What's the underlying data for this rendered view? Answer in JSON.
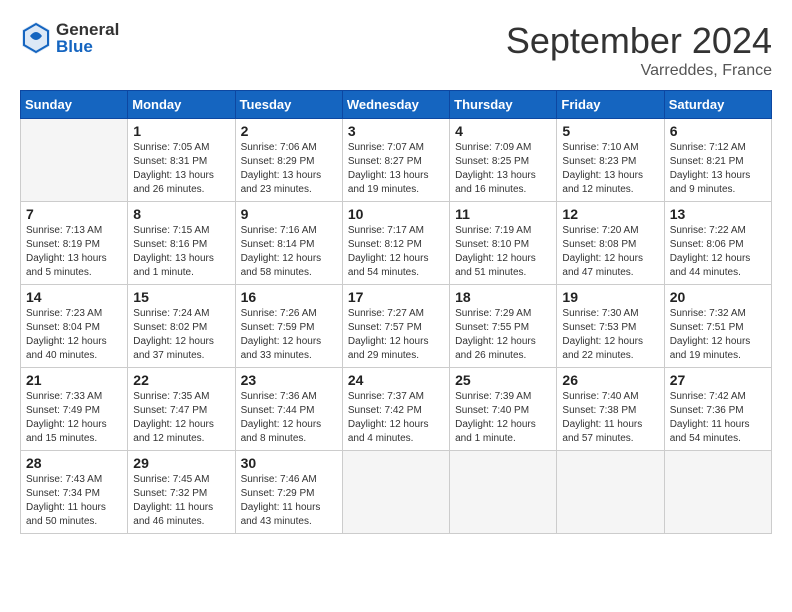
{
  "header": {
    "logo_general": "General",
    "logo_blue": "Blue",
    "month_title": "September 2024",
    "subtitle": "Varreddes, France"
  },
  "weekdays": [
    "Sunday",
    "Monday",
    "Tuesday",
    "Wednesday",
    "Thursday",
    "Friday",
    "Saturday"
  ],
  "days": [
    {
      "num": "",
      "info": "",
      "empty": true
    },
    {
      "num": "1",
      "info": "Sunrise: 7:05 AM\nSunset: 8:31 PM\nDaylight: 13 hours\nand 26 minutes."
    },
    {
      "num": "2",
      "info": "Sunrise: 7:06 AM\nSunset: 8:29 PM\nDaylight: 13 hours\nand 23 minutes."
    },
    {
      "num": "3",
      "info": "Sunrise: 7:07 AM\nSunset: 8:27 PM\nDaylight: 13 hours\nand 19 minutes."
    },
    {
      "num": "4",
      "info": "Sunrise: 7:09 AM\nSunset: 8:25 PM\nDaylight: 13 hours\nand 16 minutes."
    },
    {
      "num": "5",
      "info": "Sunrise: 7:10 AM\nSunset: 8:23 PM\nDaylight: 13 hours\nand 12 minutes."
    },
    {
      "num": "6",
      "info": "Sunrise: 7:12 AM\nSunset: 8:21 PM\nDaylight: 13 hours\nand 9 minutes."
    },
    {
      "num": "7",
      "info": "Sunrise: 7:13 AM\nSunset: 8:19 PM\nDaylight: 13 hours\nand 5 minutes."
    },
    {
      "num": "8",
      "info": "Sunrise: 7:15 AM\nSunset: 8:16 PM\nDaylight: 13 hours\nand 1 minute."
    },
    {
      "num": "9",
      "info": "Sunrise: 7:16 AM\nSunset: 8:14 PM\nDaylight: 12 hours\nand 58 minutes."
    },
    {
      "num": "10",
      "info": "Sunrise: 7:17 AM\nSunset: 8:12 PM\nDaylight: 12 hours\nand 54 minutes."
    },
    {
      "num": "11",
      "info": "Sunrise: 7:19 AM\nSunset: 8:10 PM\nDaylight: 12 hours\nand 51 minutes."
    },
    {
      "num": "12",
      "info": "Sunrise: 7:20 AM\nSunset: 8:08 PM\nDaylight: 12 hours\nand 47 minutes."
    },
    {
      "num": "13",
      "info": "Sunrise: 7:22 AM\nSunset: 8:06 PM\nDaylight: 12 hours\nand 44 minutes."
    },
    {
      "num": "14",
      "info": "Sunrise: 7:23 AM\nSunset: 8:04 PM\nDaylight: 12 hours\nand 40 minutes."
    },
    {
      "num": "15",
      "info": "Sunrise: 7:24 AM\nSunset: 8:02 PM\nDaylight: 12 hours\nand 37 minutes."
    },
    {
      "num": "16",
      "info": "Sunrise: 7:26 AM\nSunset: 7:59 PM\nDaylight: 12 hours\nand 33 minutes."
    },
    {
      "num": "17",
      "info": "Sunrise: 7:27 AM\nSunset: 7:57 PM\nDaylight: 12 hours\nand 29 minutes."
    },
    {
      "num": "18",
      "info": "Sunrise: 7:29 AM\nSunset: 7:55 PM\nDaylight: 12 hours\nand 26 minutes."
    },
    {
      "num": "19",
      "info": "Sunrise: 7:30 AM\nSunset: 7:53 PM\nDaylight: 12 hours\nand 22 minutes."
    },
    {
      "num": "20",
      "info": "Sunrise: 7:32 AM\nSunset: 7:51 PM\nDaylight: 12 hours\nand 19 minutes."
    },
    {
      "num": "21",
      "info": "Sunrise: 7:33 AM\nSunset: 7:49 PM\nDaylight: 12 hours\nand 15 minutes."
    },
    {
      "num": "22",
      "info": "Sunrise: 7:35 AM\nSunset: 7:47 PM\nDaylight: 12 hours\nand 12 minutes."
    },
    {
      "num": "23",
      "info": "Sunrise: 7:36 AM\nSunset: 7:44 PM\nDaylight: 12 hours\nand 8 minutes."
    },
    {
      "num": "24",
      "info": "Sunrise: 7:37 AM\nSunset: 7:42 PM\nDaylight: 12 hours\nand 4 minutes."
    },
    {
      "num": "25",
      "info": "Sunrise: 7:39 AM\nSunset: 7:40 PM\nDaylight: 12 hours\nand 1 minute."
    },
    {
      "num": "26",
      "info": "Sunrise: 7:40 AM\nSunset: 7:38 PM\nDaylight: 11 hours\nand 57 minutes."
    },
    {
      "num": "27",
      "info": "Sunrise: 7:42 AM\nSunset: 7:36 PM\nDaylight: 11 hours\nand 54 minutes."
    },
    {
      "num": "28",
      "info": "Sunrise: 7:43 AM\nSunset: 7:34 PM\nDaylight: 11 hours\nand 50 minutes."
    },
    {
      "num": "29",
      "info": "Sunrise: 7:45 AM\nSunset: 7:32 PM\nDaylight: 11 hours\nand 46 minutes."
    },
    {
      "num": "30",
      "info": "Sunrise: 7:46 AM\nSunset: 7:29 PM\nDaylight: 11 hours\nand 43 minutes."
    },
    {
      "num": "",
      "info": "",
      "empty": true
    },
    {
      "num": "",
      "info": "",
      "empty": true
    },
    {
      "num": "",
      "info": "",
      "empty": true
    },
    {
      "num": "",
      "info": "",
      "empty": true
    }
  ]
}
